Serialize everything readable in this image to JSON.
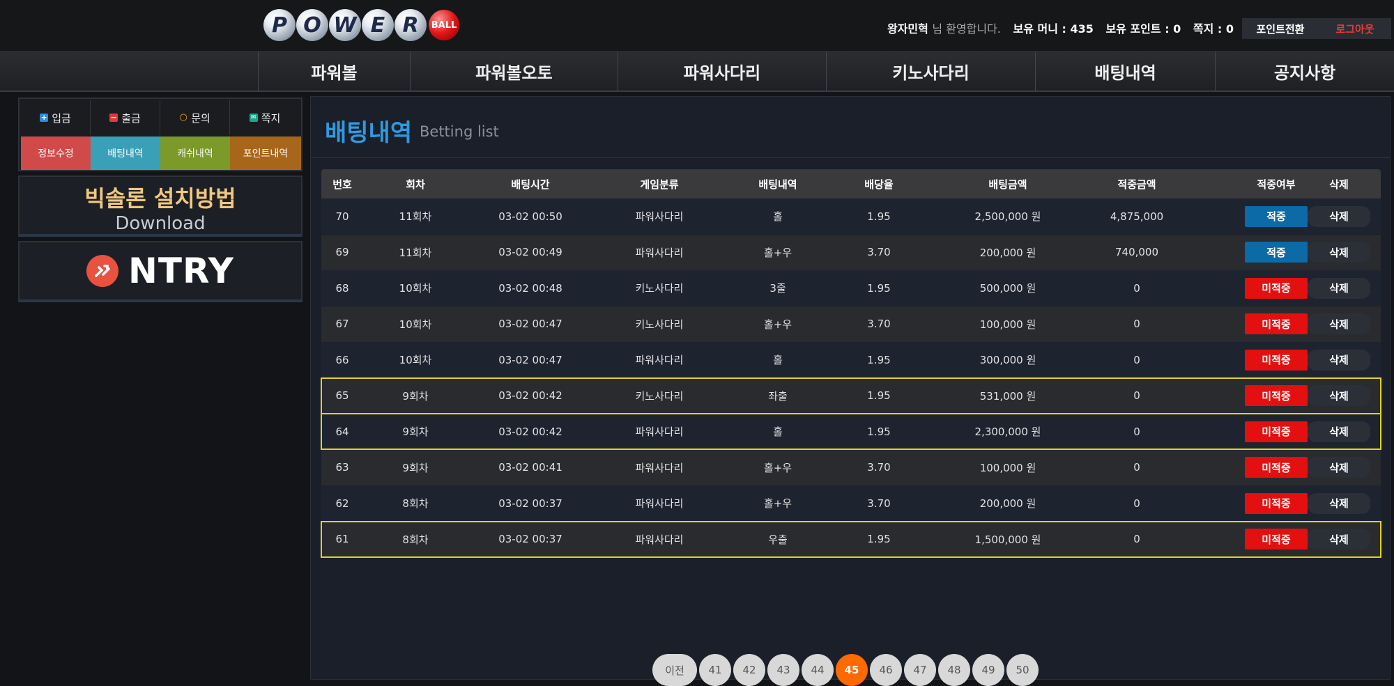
{
  "logo": {
    "letters": [
      "P",
      "O",
      "W",
      "E",
      "R"
    ],
    "ball_text": "BALL"
  },
  "header": {
    "username": "왕자민혁",
    "greeting": "님 환영합니다.",
    "money_label": "보유 머니 : 435",
    "point_label": "보유 포인트 : 0",
    "memo_label": "쪽지 : 0",
    "convert_button": "포인트전환",
    "logout_button": "로그아웃"
  },
  "nav": [
    "파워볼",
    "파워볼오토",
    "파워사다리",
    "키노사다리",
    "배팅내역",
    "공지사항"
  ],
  "sidebar": {
    "top_buttons": [
      {
        "label": "입금",
        "icon": "plus-square-icon"
      },
      {
        "label": "출금",
        "icon": "minus-square-icon"
      },
      {
        "label": "문의",
        "icon": "chat-bubbles-icon"
      },
      {
        "label": "쪽지",
        "icon": "envelope-icon"
      }
    ],
    "bottom_buttons": [
      {
        "label": "정보수정",
        "color": "#d14a4a"
      },
      {
        "label": "배팅내역",
        "color": "#3aa0b8"
      },
      {
        "label": "캐쉬내역",
        "color": "#7b9a2a"
      },
      {
        "label": "포인트내역",
        "color": "#a8661a"
      }
    ],
    "promo1_line1": "빅솔론 설치방법",
    "promo1_line2": "Download",
    "promo2_text": "NTRY"
  },
  "page": {
    "title": "배팅내역",
    "subtitle": "Betting list"
  },
  "table": {
    "headers": [
      "번호",
      "회차",
      "배팅시간",
      "게임분류",
      "배팅내역",
      "배당율",
      "배팅금액",
      "적중금액",
      "적중여부",
      "삭제"
    ],
    "rows": [
      {
        "no": "70",
        "round": "11회차",
        "time": "03-02 00:50",
        "game": "파워사다리",
        "bet": "홀",
        "odds": "1.95",
        "amount": "2,500,000 원",
        "win_amount": "4,875,000",
        "result": "적중",
        "delete": "삭제"
      },
      {
        "no": "69",
        "round": "11회차",
        "time": "03-02 00:49",
        "game": "파워사다리",
        "bet": "홀+우",
        "odds": "3.70",
        "amount": "200,000 원",
        "win_amount": "740,000",
        "result": "적중",
        "delete": "삭제"
      },
      {
        "no": "68",
        "round": "10회차",
        "time": "03-02 00:48",
        "game": "키노사다리",
        "bet": "3줄",
        "odds": "1.95",
        "amount": "500,000 원",
        "win_amount": "0",
        "result": "미적중",
        "delete": "삭제"
      },
      {
        "no": "67",
        "round": "10회차",
        "time": "03-02 00:47",
        "game": "키노사다리",
        "bet": "홀+우",
        "odds": "3.70",
        "amount": "100,000 원",
        "win_amount": "0",
        "result": "미적중",
        "delete": "삭제"
      },
      {
        "no": "66",
        "round": "10회차",
        "time": "03-02 00:47",
        "game": "파워사다리",
        "bet": "홀",
        "odds": "1.95",
        "amount": "300,000 원",
        "win_amount": "0",
        "result": "미적중",
        "delete": "삭제"
      },
      {
        "no": "65",
        "round": "9회차",
        "time": "03-02 00:42",
        "game": "키노사다리",
        "bet": "좌출",
        "odds": "1.95",
        "amount": "531,000 원",
        "win_amount": "0",
        "result": "미적중",
        "delete": "삭제"
      },
      {
        "no": "64",
        "round": "9회차",
        "time": "03-02 00:42",
        "game": "파워사다리",
        "bet": "홀",
        "odds": "1.95",
        "amount": "2,300,000 원",
        "win_amount": "0",
        "result": "미적중",
        "delete": "삭제"
      },
      {
        "no": "63",
        "round": "9회차",
        "time": "03-02 00:41",
        "game": "파워사다리",
        "bet": "홀+우",
        "odds": "3.70",
        "amount": "100,000 원",
        "win_amount": "0",
        "result": "미적중",
        "delete": "삭제"
      },
      {
        "no": "62",
        "round": "8회차",
        "time": "03-02 00:37",
        "game": "파워사다리",
        "bet": "홀+우",
        "odds": "3.70",
        "amount": "200,000 원",
        "win_amount": "0",
        "result": "미적중",
        "delete": "삭제"
      },
      {
        "no": "61",
        "round": "8회차",
        "time": "03-02 00:37",
        "game": "파워사다리",
        "bet": "우출",
        "odds": "1.95",
        "amount": "1,500,000 원",
        "win_amount": "0",
        "result": "미적중",
        "delete": "삭제"
      }
    ],
    "highlighted_rows": [
      "65",
      "64",
      "61"
    ]
  },
  "pagination": {
    "prev": "이전",
    "pages": [
      "41",
      "42",
      "43",
      "44",
      "45",
      "46",
      "47",
      "48",
      "49",
      "50"
    ],
    "current": "45"
  },
  "colors": {
    "accent_blue": "#2f9ae0",
    "win": "#0c6aa6",
    "lose": "#e40f0f",
    "highlight": "#e6d320",
    "active_page": "#ff6a00"
  }
}
